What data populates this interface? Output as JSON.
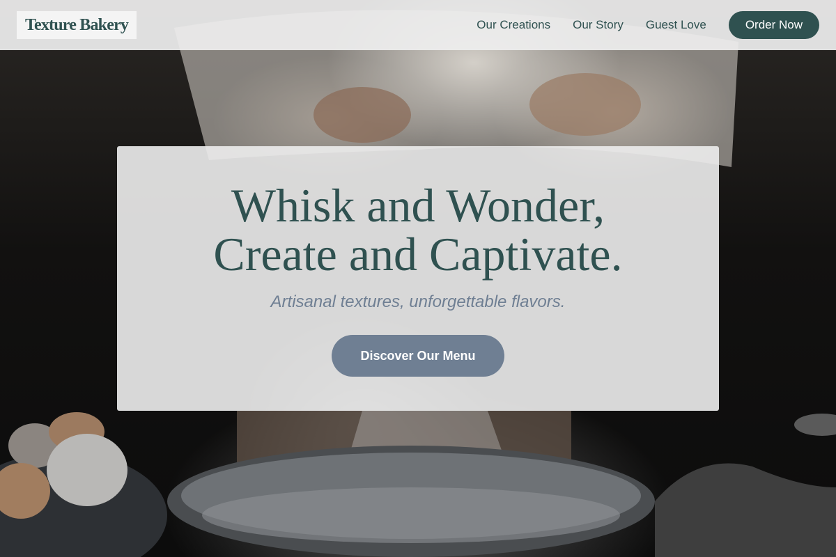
{
  "brand": {
    "name": "Texture Bakery"
  },
  "nav": {
    "links": [
      "Our Creations",
      "Our Story",
      "Guest Love"
    ],
    "cta_label": "Order Now"
  },
  "hero": {
    "title_line1": "Whisk and Wonder,",
    "title_line2": "Create and Captivate.",
    "subtitle": "Artisanal textures, unforgettable flavors.",
    "cta_label": "Discover Our Menu",
    "background_image": "baker-sifting-flour-into-bowl-photo"
  },
  "colors": {
    "primary": "#2f5150",
    "secondary": "#6f7f93",
    "header_bg": "#eeeeee"
  }
}
